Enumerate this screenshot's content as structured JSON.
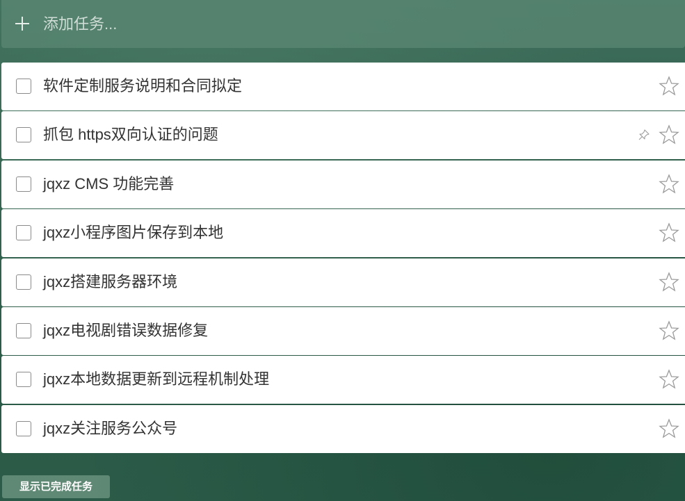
{
  "add_task": {
    "placeholder": "添加任务..."
  },
  "tasks": [
    {
      "title": "软件定制服务说明和合同拟定",
      "pinned": false,
      "starred": false
    },
    {
      "title": "抓包 https双向认证的问题",
      "pinned": true,
      "starred": false
    },
    {
      "title": "jqxz CMS 功能完善",
      "pinned": false,
      "starred": false
    },
    {
      "title": "jqxz小程序图片保存到本地",
      "pinned": false,
      "starred": false
    },
    {
      "title": "jqxz搭建服务器环境",
      "pinned": false,
      "starred": false
    },
    {
      "title": "jqxz电视剧错误数据修复",
      "pinned": false,
      "starred": false
    },
    {
      "title": "jqxz本地数据更新到远程机制处理",
      "pinned": false,
      "starred": false
    },
    {
      "title": "jqxz关注服务公众号",
      "pinned": false,
      "starred": false
    }
  ],
  "footer": {
    "show_completed_label": "显示已完成任务"
  },
  "icons": {
    "add": "plus-icon",
    "star": "star-icon",
    "pin": "pin-icon"
  },
  "colors": {
    "task_background": "#ffffff",
    "task_text": "#333333",
    "accent_green": "#3f6f5c"
  }
}
